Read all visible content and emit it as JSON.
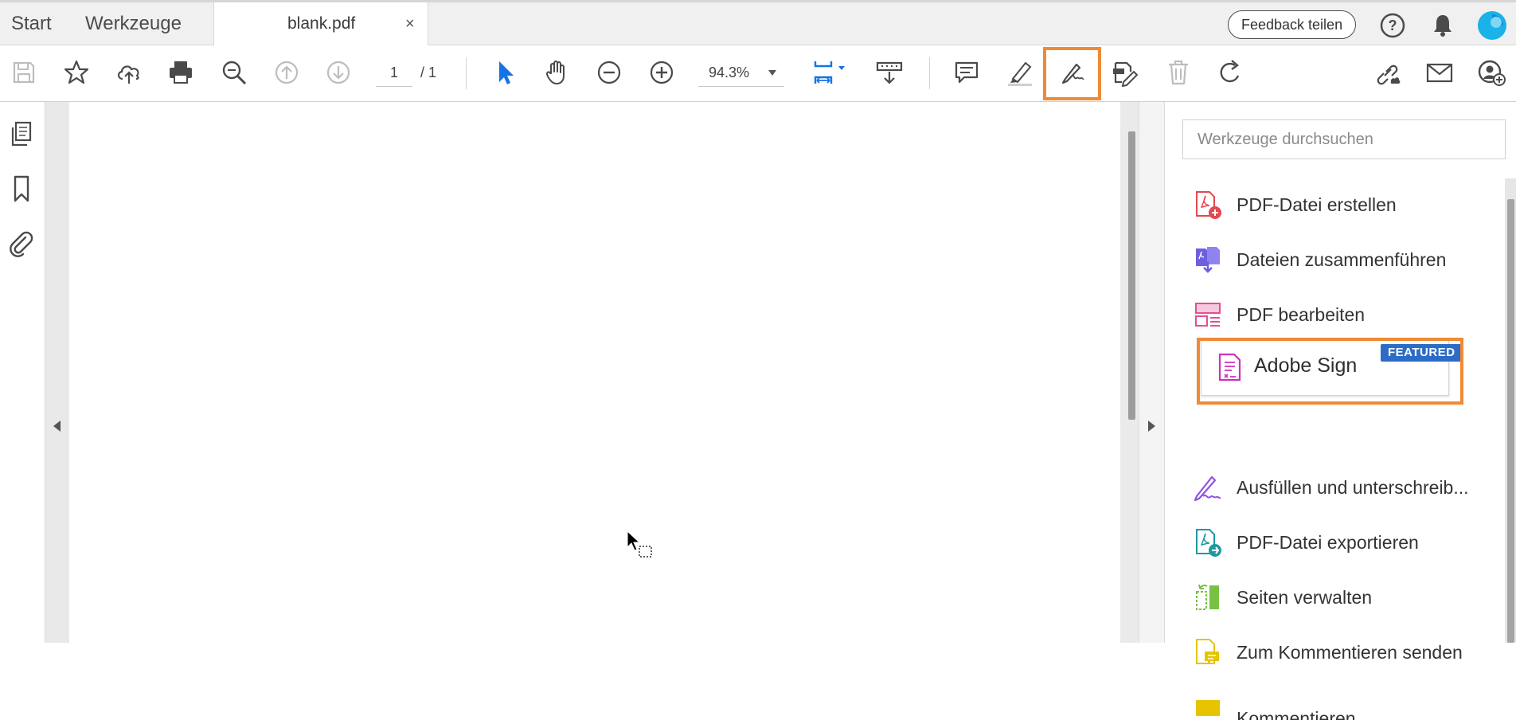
{
  "tabs": {
    "start": "Start",
    "tools": "Werkzeuge",
    "document": "blank.pdf",
    "close": "×"
  },
  "header": {
    "feedback_label": "Feedback teilen",
    "help_icon": "help-icon",
    "bell_icon": "notification-bell-icon",
    "avatar_icon": "account-avatar-icon"
  },
  "toolbar": {
    "page_current": "1",
    "page_total": "/  1",
    "zoom_value": "94.3%",
    "icons": [
      "save-icon",
      "bookmark-star-icon",
      "cloud-upload-icon",
      "print-icon",
      "search-zoom-icon",
      "page-up-icon",
      "page-down-icon",
      "select-cursor-icon",
      "hand-pan-icon",
      "zoom-out-icon",
      "zoom-in-icon",
      "fit-page-icon",
      "scroll-mode-icon",
      "comment-icon",
      "highlight-icon",
      "sign-pen-icon",
      "edit-pdf-icon",
      "delete-icon",
      "rotate-icon",
      "share-link-icon",
      "email-icon",
      "share-user-icon"
    ]
  },
  "leftnav": {
    "icons": [
      "page-thumbnails-icon",
      "bookmarks-icon",
      "attachments-icon"
    ]
  },
  "tools_pane": {
    "search_placeholder": "Werkzeuge durchsuchen",
    "items": [
      {
        "label": "PDF-Datei erstellen",
        "color": "#e34850"
      },
      {
        "label": "Dateien zusammenführen",
        "color": "#6e5fe0"
      },
      {
        "label": "PDF bearbeiten",
        "color": "#e54e94"
      },
      {
        "label": "Adobe Sign",
        "color": "#d12fc0",
        "badge": "FEATURED"
      },
      {
        "label": "Ausfüllen und unterschreib...",
        "color": "#8e52e3"
      },
      {
        "label": "PDF-Datei exportieren",
        "color": "#1d9aa1"
      },
      {
        "label": "Seiten verwalten",
        "color": "#7ac143"
      },
      {
        "label": "Zum Kommentieren senden",
        "color": "#e8c400"
      },
      {
        "label": "Kommentieren",
        "color": "#e8c400"
      }
    ]
  },
  "colors": {
    "highlight_outline": "#f08a35",
    "featured_badge": "#2c6cc7",
    "accent_blue": "#1473e6"
  }
}
